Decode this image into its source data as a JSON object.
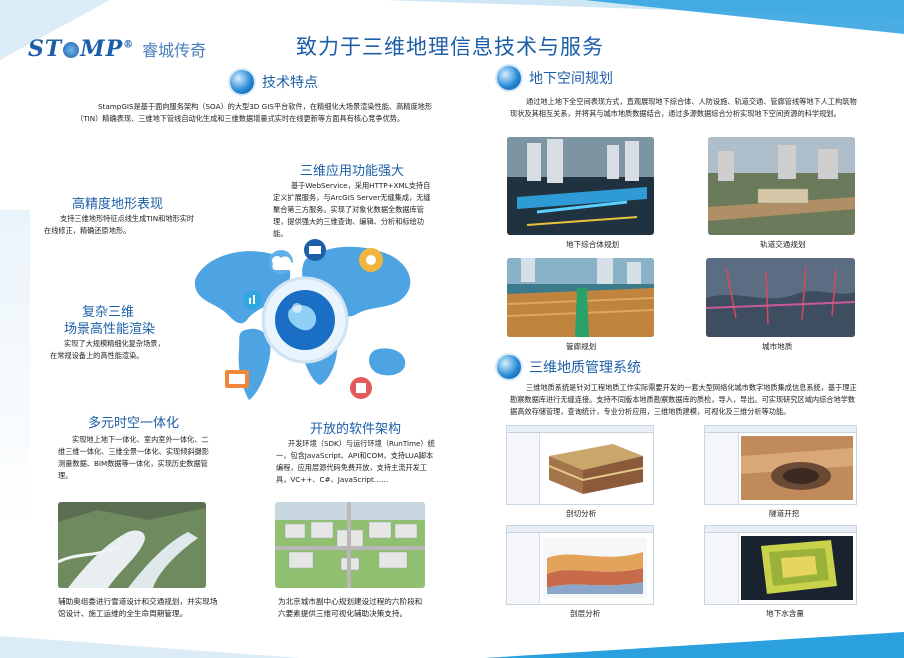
{
  "brand": {
    "logo_text": "ST",
    "logo_text2": "MP",
    "logo_reg": "®",
    "company": "睿城传奇"
  },
  "main_title": "致力于三维地理信息技术与服务",
  "tech": {
    "title": "技术特点",
    "intro": "StampGIS是基于面向服务架构（SOA）的大型3D GIS平台软件，在精细化大场景渲染性能、高精度地形（TIN）精确表现、三维地下管线自动化生成和三维数据增量式实时在线更新等方面具有核心竞争优势。"
  },
  "features": {
    "f1": {
      "title": "三维应用功能强大",
      "desc": "基于WebService，采用HTTP+XML支持自定义扩展服务，与ArcGIS Server无缝集成，无缝聚合第三方服务。实现了对象化数据全数据库管理，提供强大的三维查询、编辑、分析和标绘功能。"
    },
    "f2": {
      "title": "高精度地形表现",
      "desc": "支持三维地形特征点线生成TIN和地形实时在线修正，精确还原地形。"
    },
    "f3": {
      "title1": "复杂三维",
      "title2": "场景高性能渲染",
      "desc": "实现了大规模精细化复杂场景，在常规设备上的高性能渲染。"
    },
    "f4": {
      "title": "多元时空一体化",
      "desc": "实现地上地下一体化、室内室外一体化、二维三维一体化、三维全景一体化、实现倾斜摄影测量数据、BIM数据等一体化，实现历史数据管理。"
    },
    "f5": {
      "title": "开放的软件架构",
      "desc": "开发环境（SDK）与运行环境（RunTime）统一，包含JavaScript、API和COM，支持LUA脚本编程，应用层源代码免费开放，支持主流开发工具，VC++、C#、JavaScript……"
    }
  },
  "bottom_captions": {
    "left": "辅助奥组委进行雪道设计和交通规划，并实现场馆设计、施工运维的全生命周期管理。",
    "right": "为北京城市副中心规划建设过程的六阶段和六要素提供三维可视化辅助决策支持。"
  },
  "underground": {
    "title": "地下空间规划",
    "desc": "通过地上地下全空间表现方式，直观展现地下综合体、人防设施、轨道交通、管廊管线等地下人工构筑物现状及其相互关系，并将其与城市地质数据结合，通过多源数据综合分析实现地下空间资源的科学规划。",
    "captions": [
      "地下综合体规划",
      "轨道交通规划",
      "管廊规划",
      "城市地质"
    ]
  },
  "geology": {
    "title": "三维地质管理系统",
    "desc": "三维地质系统是针对工程地质工作实际需要开发的一套大型网络化城市数字地质集成信息系统，基于理正勘察数据库进行无缝连接。支持不同版本地质勘察数据库的质检，导入，导出。可实现研究区域内综合地学数据高效存储管理，查询统计，专业分析应用，三维地质建模，可视化及三维分析等功能。",
    "captions": [
      "剖切分析",
      "隧道开挖",
      "剖层分析",
      "地下水含量"
    ]
  }
}
